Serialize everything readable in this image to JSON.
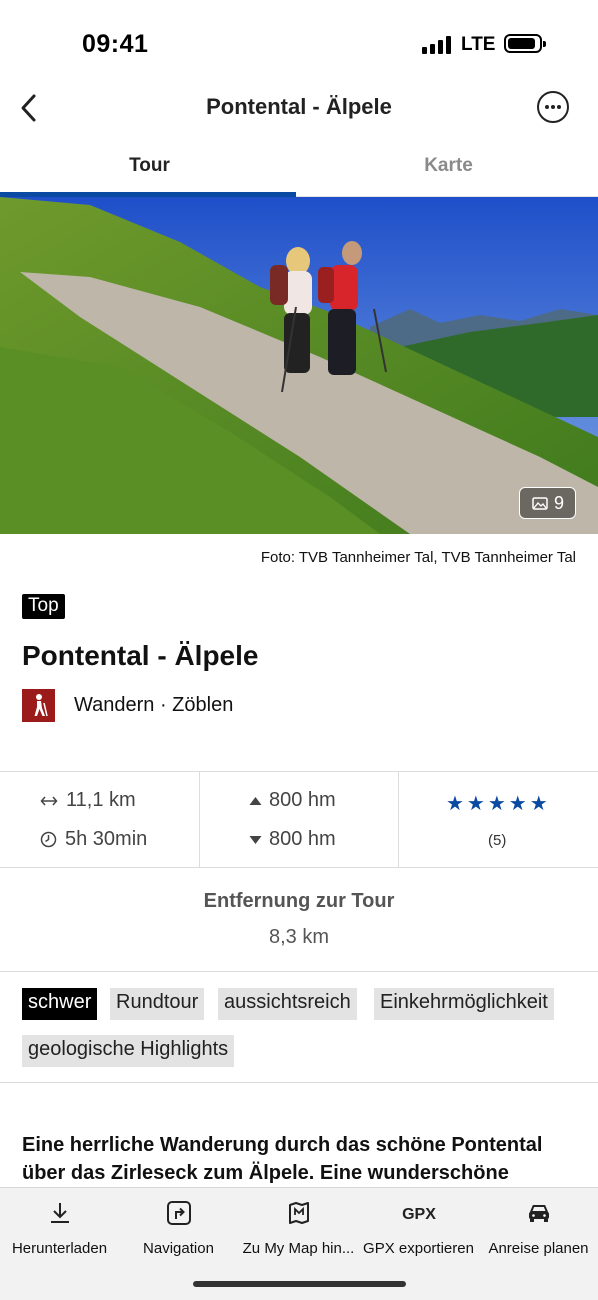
{
  "status_bar": {
    "time": "09:41",
    "network": "LTE"
  },
  "header": {
    "title": "Pontental - Älpele"
  },
  "tabs": [
    {
      "label": "Tour",
      "active": true
    },
    {
      "label": "Karte",
      "active": false
    }
  ],
  "hero": {
    "image_count": "9",
    "credit": "Foto: TVB Tannheimer Tal, TVB Tannheimer Tal"
  },
  "tour": {
    "badge": "Top",
    "title": "Pontental - Älpele",
    "category": "Wandern · Zöblen",
    "category_color": "#9b1b1b"
  },
  "stats": {
    "distance": "11,1 km",
    "duration": "5h 30min",
    "ascent": "800 hm",
    "descent": "800 hm",
    "rating_stars": 5,
    "rating_count": "(5)",
    "accent_color": "#0b4aa2"
  },
  "distance_to_tour": {
    "label": "Entfernung zur Tour",
    "value": "8,3 km"
  },
  "tags": [
    {
      "label": "schwer",
      "highlight": true
    },
    {
      "label": "Rundtour",
      "highlight": false
    },
    {
      "label": "aussichtsreich",
      "highlight": false
    },
    {
      "label": "Einkehrmöglichkeit",
      "highlight": false
    },
    {
      "label": "geologische Highlights",
      "highlight": false
    }
  ],
  "description": "Eine herrliche Wanderung durch das schöne Pontental über das Zirleseck zum Älpele. Eine wunderschöne",
  "toolbar": [
    {
      "label": "Herunterladen",
      "icon": "download-icon"
    },
    {
      "label": "Navigation",
      "icon": "navigation-icon"
    },
    {
      "label": "Zu My Map hin...",
      "icon": "map-icon"
    },
    {
      "label": "GPX exportieren",
      "icon": "gpx-icon"
    },
    {
      "label": "Anreise planen",
      "icon": "car-icon"
    }
  ]
}
